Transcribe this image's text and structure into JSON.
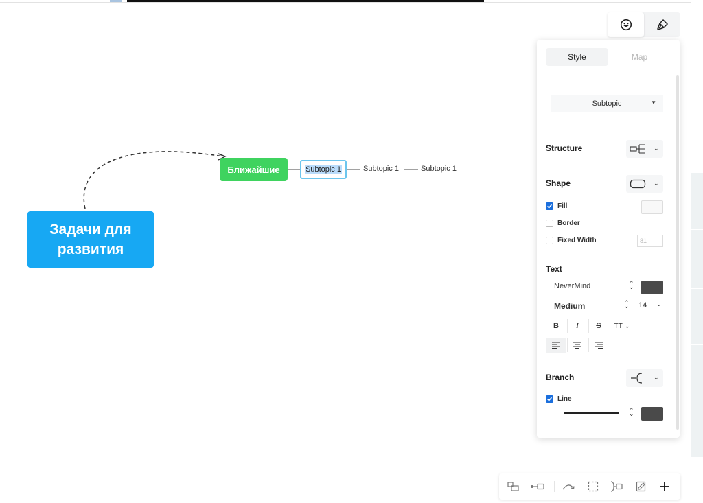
{
  "canvas": {
    "root_topic": "Задачи для\nразвития",
    "main_topic": "Ближайшие",
    "subtopics": [
      "Subtopic 1",
      "Subtopic 1",
      "Subtopic 1"
    ]
  },
  "top_tabs": [
    {
      "icon": "smiley-face-icon",
      "active": true
    },
    {
      "icon": "paint-brush-icon",
      "active": false
    }
  ],
  "panel": {
    "tabs": [
      {
        "label": "Style",
        "active": true
      },
      {
        "label": "Map",
        "active": false
      }
    ],
    "topic_type": "Subtopic",
    "structure": {
      "title": "Structure",
      "icon": "structure-logic-right-icon"
    },
    "shape": {
      "title": "Shape",
      "icon": "rounded-rectangle-icon",
      "fill": {
        "label": "Fill",
        "checked": true
      },
      "border": {
        "label": "Border",
        "checked": false
      },
      "fixed_width": {
        "label": "Fixed Width",
        "checked": false,
        "value": "81"
      }
    },
    "text": {
      "title": "Text",
      "font_family": "NeverMind",
      "font_weight": "Medium",
      "font_size": "14",
      "color": "#4a4a4a",
      "format_buttons": {
        "bold": "B",
        "italic": "I",
        "strike": "S",
        "case": "TT"
      }
    },
    "branch": {
      "title": "Branch",
      "icon": "branch-bracket-icon",
      "line": {
        "label": "Line",
        "checked": true
      },
      "color": "#4a4a4a"
    }
  },
  "bottom_toolbar": [
    "add-floating-topic-icon",
    "add-relationship-topic-icon",
    "relationship-curve-icon",
    "boundary-icon",
    "summary-icon",
    "note-icon",
    "add-icon"
  ],
  "colors": {
    "root": "#17a8f3",
    "main_topic": "#3fd35f",
    "selection": "#6cc6ee",
    "checkbox": "#1b6fdd"
  }
}
